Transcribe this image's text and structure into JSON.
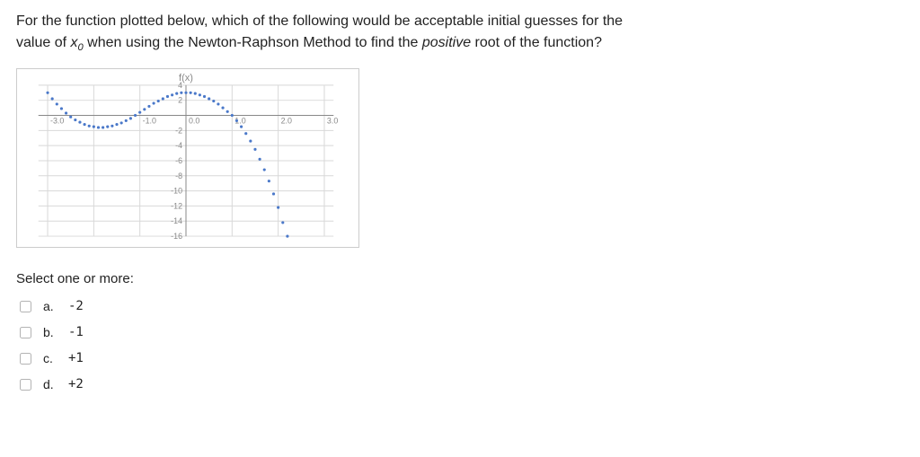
{
  "question": {
    "line1": "For the function plotted below, which of the following would be acceptable initial guesses for the",
    "line2_pre": "value of ",
    "line2_var": "x",
    "line2_sub": "0",
    "line2_mid": " when using the Newton-Raphson Method to find the ",
    "line2_em": "positive",
    "line2_post": " root of the function?"
  },
  "chart_data": {
    "type": "scatter",
    "title": "f(x)",
    "xlabel": "",
    "ylabel": "",
    "x_ticks": [
      -3.0,
      -1.0,
      0.0,
      1.0,
      2.0,
      3.0
    ],
    "y_ticks": [
      4,
      2,
      -2,
      -4,
      -6,
      -8,
      -10,
      -12,
      -14,
      -16
    ],
    "xlim": [
      -3.2,
      3.2
    ],
    "ylim": [
      -16,
      4
    ],
    "series": [
      {
        "name": "f(x)",
        "x": [
          -3.0,
          -2.9,
          -2.8,
          -2.7,
          -2.6,
          -2.5,
          -2.4,
          -2.3,
          -2.2,
          -2.1,
          -2.0,
          -1.9,
          -1.8,
          -1.7,
          -1.6,
          -1.5,
          -1.4,
          -1.3,
          -1.2,
          -1.1,
          -1.0,
          -0.9,
          -0.8,
          -0.7,
          -0.6,
          -0.5,
          -0.4,
          -0.3,
          -0.2,
          -0.1,
          0.0,
          0.1,
          0.2,
          0.3,
          0.4,
          0.5,
          0.6,
          0.7,
          0.8,
          0.9,
          1.0,
          1.1,
          1.2,
          1.3,
          1.4,
          1.5,
          1.6,
          1.7,
          1.8,
          1.9,
          2.0,
          2.1,
          2.2
        ],
        "y": [
          3.0,
          2.2,
          1.5,
          0.9,
          0.3,
          -0.2,
          -0.6,
          -0.9,
          -1.2,
          -1.4,
          -1.5,
          -1.6,
          -1.6,
          -1.5,
          -1.4,
          -1.2,
          -1.0,
          -0.7,
          -0.4,
          0.0,
          0.4,
          0.8,
          1.2,
          1.6,
          1.9,
          2.2,
          2.5,
          2.7,
          2.9,
          3.0,
          3.0,
          3.0,
          2.9,
          2.7,
          2.5,
          2.2,
          1.9,
          1.5,
          1.0,
          0.5,
          0.0,
          -0.7,
          -1.5,
          -2.4,
          -3.4,
          -4.5,
          -5.8,
          -7.2,
          -8.7,
          -10.4,
          -12.2,
          -14.2,
          -16.0
        ]
      }
    ]
  },
  "select_prompt": "Select one or more:",
  "options": [
    {
      "letter": "a.",
      "value": "-2"
    },
    {
      "letter": "b.",
      "value": "-1"
    },
    {
      "letter": "c.",
      "value": "+1"
    },
    {
      "letter": "d.",
      "value": "+2"
    }
  ]
}
